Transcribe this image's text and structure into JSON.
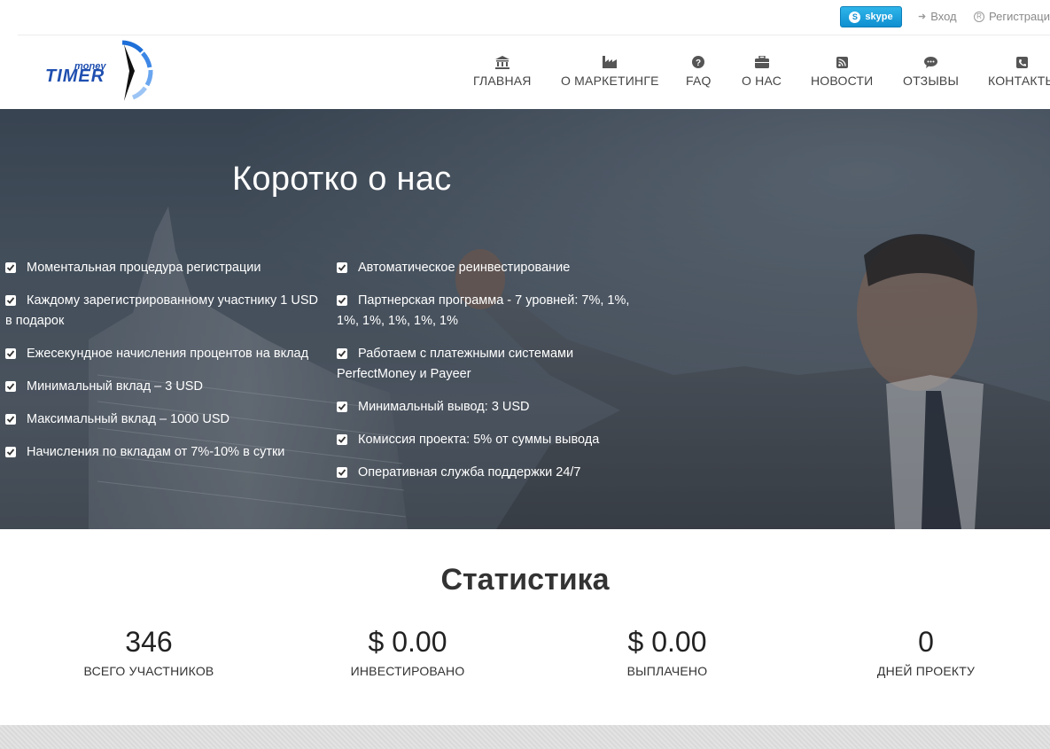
{
  "topbar": {
    "skype_label": "skype",
    "login_label": "Вход",
    "register_label": "Регистрация"
  },
  "logo": {
    "line1": "money",
    "line2": "TIMER"
  },
  "nav": {
    "items": [
      {
        "label": "ГЛАВНАЯ",
        "icon": "bank-icon"
      },
      {
        "label": "О МАРКЕТИНГЕ",
        "icon": "industry-icon"
      },
      {
        "label": "FAQ",
        "icon": "question-circle-icon"
      },
      {
        "label": "О НАС",
        "icon": "briefcase-icon"
      },
      {
        "label": "НОВОСТИ",
        "icon": "rss-icon"
      },
      {
        "label": "ОТЗЫВЫ",
        "icon": "comment-icon"
      },
      {
        "label": "КОНТАКТЫ",
        "icon": "phone-icon"
      }
    ]
  },
  "hero": {
    "title": "Коротко о нас",
    "left_features": [
      "Моментальная процедура регистрации",
      "Каждому зарегистрированному участнику 1 USD в подарок",
      "Ежесекундное начисления процентов на вклад",
      "Минимальный вклад – 3 USD",
      "Максимальный вклад – 1000 USD",
      "Начисления по вкладам от 7%-10% в сутки"
    ],
    "right_features": [
      "Автоматическое реинвестирование",
      "Партнерская программа - 7 уровней: 7%, 1%, 1%, 1%, 1%, 1%, 1%",
      "Работаем с платежными системами PerfectMoney и Payeer",
      "Минимальный вывод: 3 USD",
      "Комиссия проекта: 5% от суммы вывода",
      "Оперативная служба поддержки 24/7"
    ]
  },
  "stats": {
    "title": "Статистика",
    "items": [
      {
        "value": "346",
        "label": "ВСЕГО УЧАСТНИКОВ"
      },
      {
        "value": "$ 0.00",
        "label": "ИНВЕСТИРОВАНО"
      },
      {
        "value": "$ 0.00",
        "label": "ВЫПЛАЧЕНО"
      },
      {
        "value": "0",
        "label": "ДНЕЙ ПРОЕКТУ"
      }
    ]
  },
  "colors": {
    "skype": "#1c9fdd",
    "hero_overlay": "#4c5966",
    "logo_blue": "#1e6fd6"
  }
}
